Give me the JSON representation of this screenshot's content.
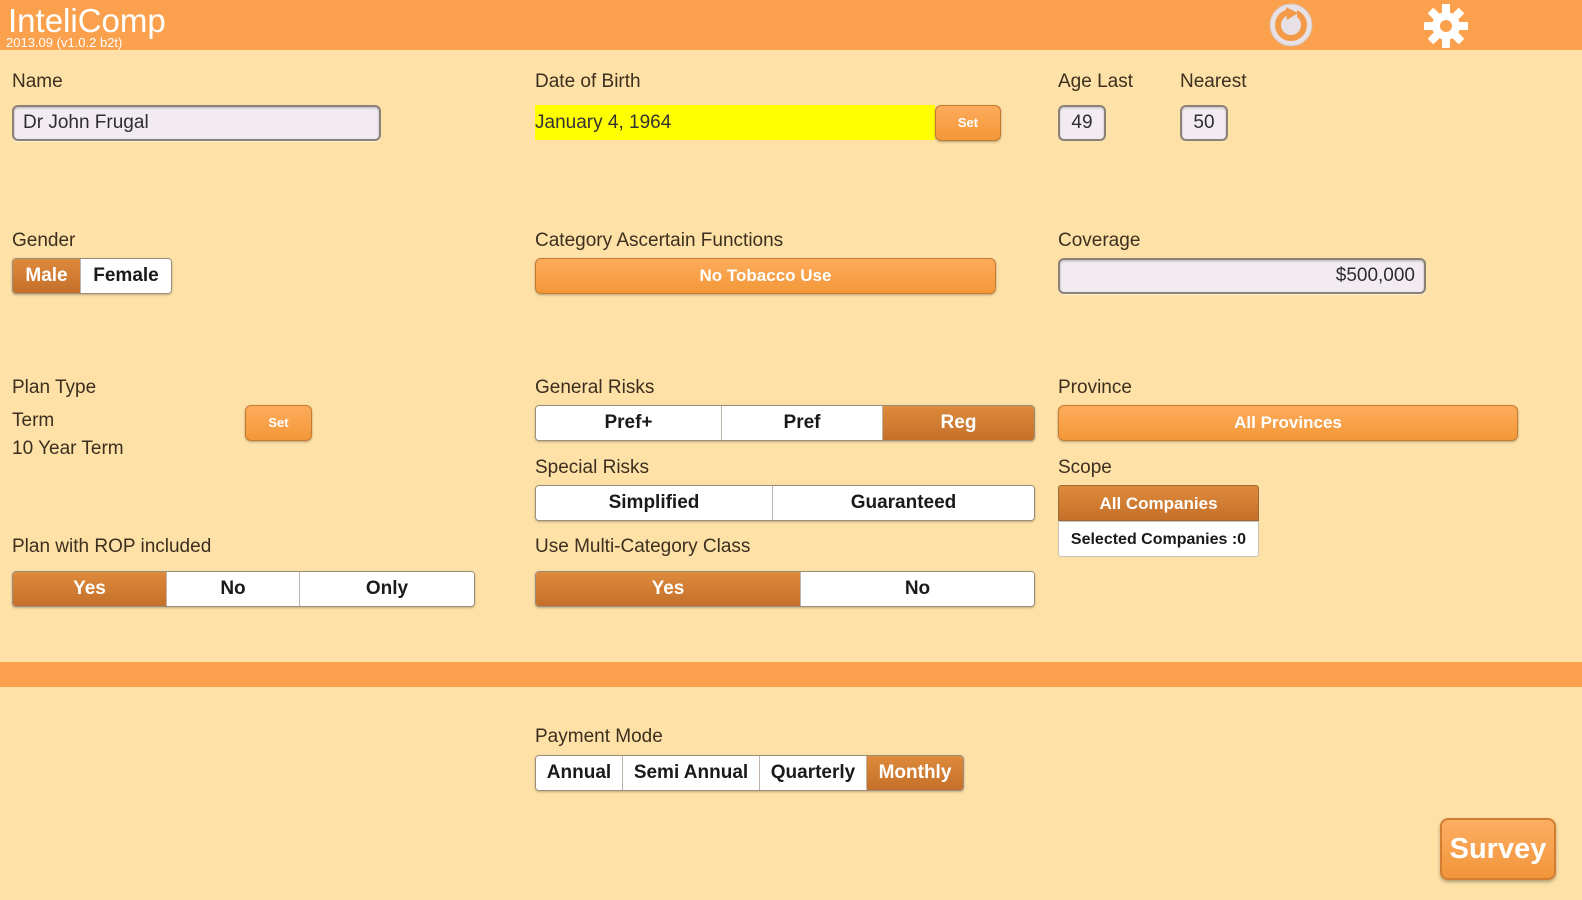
{
  "header": {
    "title": "InteliComp",
    "version": "2013.09 (v1.0.2 b2t)",
    "refresh_icon": "refresh-icon",
    "settings_icon": "gear-icon",
    "color": "#fba14e"
  },
  "name": {
    "label": "Name",
    "value": "Dr John Frugal"
  },
  "dob": {
    "label": "Date of Birth",
    "value": "January 4, 1964",
    "set_label": "Set",
    "highlight": "#ffff00"
  },
  "age": {
    "last_label": "Age Last",
    "last_value": "49",
    "nearest_label": "Nearest",
    "nearest_value": "50"
  },
  "gender": {
    "label": "Gender",
    "options": [
      "Male",
      "Female"
    ],
    "selected": "Male"
  },
  "category": {
    "label": "Category Ascertain Functions",
    "value": "No Tobacco Use"
  },
  "coverage": {
    "label": "Coverage",
    "value": "$500,000"
  },
  "plan_type": {
    "label": "Plan Type",
    "type": "Term",
    "detail": "10 Year Term",
    "set_label": "Set"
  },
  "general_risks": {
    "label": "General Risks",
    "options": [
      "Pref+",
      "Pref",
      "Reg"
    ],
    "selected": "Reg"
  },
  "province": {
    "label": "Province",
    "value": "All Provinces"
  },
  "special_risks": {
    "label": "Special Risks",
    "options": [
      "Simplified",
      "Guaranteed"
    ],
    "selected": null
  },
  "scope": {
    "label": "Scope",
    "all_label": "All Companies",
    "selected_label": "Selected Companies :0"
  },
  "rop": {
    "label": "Plan with ROP included",
    "options": [
      "Yes",
      "No",
      "Only"
    ],
    "selected": "Yes"
  },
  "multi_category": {
    "label": "Use Multi-Category Class",
    "options": [
      "Yes",
      "No"
    ],
    "selected": "Yes"
  },
  "payment_mode": {
    "label": "Payment Mode",
    "options": [
      "Annual",
      "Semi Annual",
      "Quarterly",
      "Monthly"
    ],
    "selected": "Monthly"
  },
  "survey": {
    "label": "Survey"
  },
  "colors": {
    "background": "#fde1a7",
    "accent": "#fba14e",
    "selected_segment": "#d07b33"
  }
}
